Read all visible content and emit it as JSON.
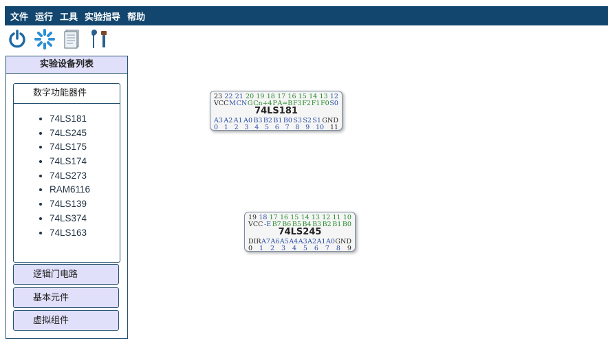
{
  "menu": [
    "文件",
    "运行",
    "工具",
    "实验指导",
    "帮助"
  ],
  "toolbar": {
    "icons": [
      "power-icon",
      "spinner-icon",
      "document-icon",
      "tools-icon"
    ]
  },
  "panel": {
    "title": "实验设备列表",
    "open_group": {
      "label": "数字功能器件",
      "items": [
        "74LS181",
        "74LS245",
        "74LS175",
        "74LS174",
        "74LS273",
        "RAM6116",
        "74LS139",
        "74LS374",
        "74LS163"
      ]
    },
    "closed_groups": [
      "逻辑门电路",
      "基本元件",
      "虚拟组件"
    ]
  },
  "chips": [
    {
      "name": "74LS181",
      "top_numbers": [
        "23",
        "22",
        "21",
        "20",
        "19",
        "18",
        "17",
        "16",
        "15",
        "14",
        "13",
        "12"
      ],
      "top_labels": [
        "VCC",
        "M",
        "CN",
        "G",
        "Cn+4",
        "P",
        "A=B",
        "F3",
        "F2",
        "F1",
        "F0",
        "S0"
      ],
      "bottom_labels": [
        "A3",
        "A2",
        "A1",
        "A0",
        "B3",
        "B2",
        "B1",
        "B0",
        "S3",
        "S2",
        "S1",
        "GND"
      ],
      "bottom_numbers": [
        "0",
        "1",
        "2",
        "3",
        "4",
        "5",
        "6",
        "7",
        "8",
        "9",
        "10",
        "11"
      ]
    },
    {
      "name": "74LS245",
      "top_numbers": [
        "19",
        "18",
        "17",
        "16",
        "15",
        "14",
        "13",
        "12",
        "11",
        "10"
      ],
      "top_labels": [
        "VCC",
        "-E",
        "B7",
        "B6",
        "B5",
        "B4",
        "B3",
        "B2",
        "B1",
        "B0"
      ],
      "bottom_labels": [
        "DIR",
        "A7",
        "A6",
        "A5",
        "A4",
        "A3",
        "A2",
        "A1",
        "A0",
        "GND"
      ],
      "bottom_numbers": [
        "0",
        "1",
        "2",
        "3",
        "4",
        "5",
        "6",
        "7",
        "8",
        "9"
      ]
    }
  ],
  "colors": {
    "menubar": "#12466e",
    "panel_head": "#e0e0fb",
    "pin_blue": "#2a4fa8",
    "pin_green": "#258a2a"
  }
}
